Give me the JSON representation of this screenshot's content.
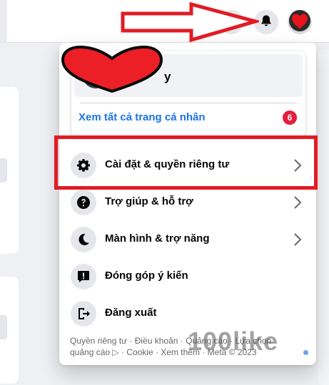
{
  "header": {
    "menu_icon": "grid-dots-icon",
    "notifications_icon": "bell-icon",
    "avatar_icon": "heart-avatar"
  },
  "profile_card": {
    "name": "y",
    "see_all_profiles": "Xem tất cả trang cá nhân",
    "badge_count": "6"
  },
  "menu": {
    "items": [
      {
        "label": "Cài đặt & quyền riêng tư",
        "icon": "gear-icon",
        "has_chevron": true
      },
      {
        "label": "Trợ giúp & hỗ trợ",
        "icon": "question-icon",
        "has_chevron": true
      },
      {
        "label": "Màn hình & trợ năng",
        "icon": "moon-icon",
        "has_chevron": true
      },
      {
        "label": "Đóng góp ý kiến",
        "icon": "feedback-icon",
        "has_chevron": false
      },
      {
        "label": "Đăng xuất",
        "icon": "logout-icon",
        "has_chevron": false
      }
    ]
  },
  "footer": {
    "line1": "Quyền riêng tư · Điều khoản · Quảng cáo · Lựa chọn",
    "line2": "quảng cáo ▷ · Cookie · Xem thêm · Meta © 2023"
  },
  "watermark": "100like",
  "colors": {
    "accent_blue": "#1b74e4",
    "badge_red": "#e41e3f",
    "highlight_red": "#e21b24"
  }
}
